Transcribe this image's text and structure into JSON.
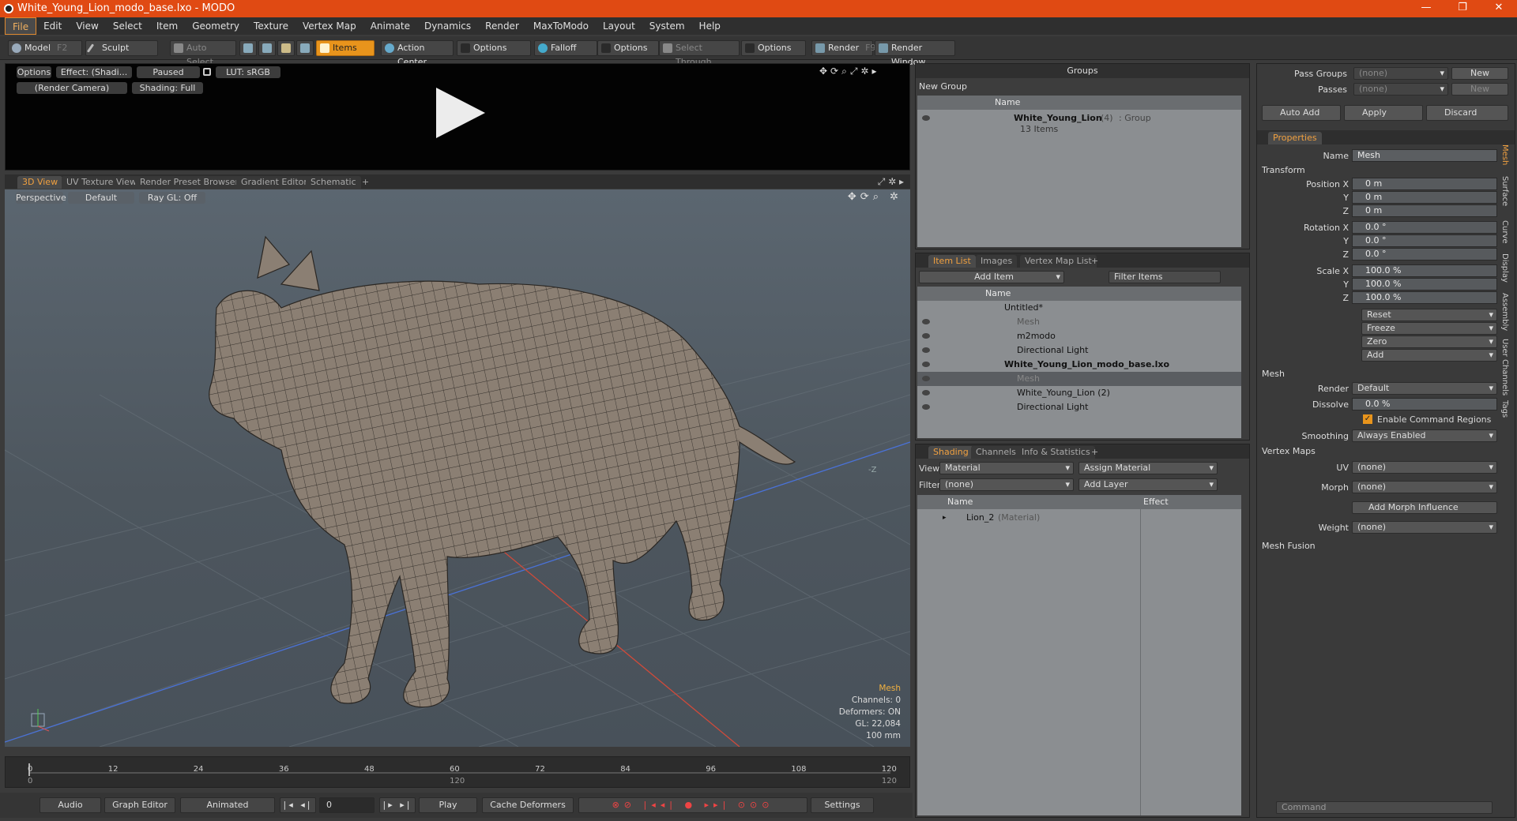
{
  "window": {
    "title": "White_Young_Lion_modo_base.lxo - MODO",
    "controls": [
      "—",
      "❐",
      "✕"
    ]
  },
  "menu": [
    "File",
    "Edit",
    "View",
    "Select",
    "Item",
    "Geometry",
    "Texture",
    "Vertex Map",
    "Animate",
    "Dynamics",
    "Render",
    "MaxToModo",
    "Layout",
    "System",
    "Help"
  ],
  "toolbar": {
    "model": "Model",
    "model_key": "F2",
    "sculpt": "Sculpt",
    "auto_select": "Auto Select",
    "items": "Items",
    "action_center": "Action Center",
    "options1": "Options",
    "falloff": "Falloff",
    "options2": "Options",
    "select_through": "Select Through",
    "options3": "Options",
    "render": "Render",
    "render_key": "F9",
    "render_window": "Render Window"
  },
  "preview": {
    "options": "Options",
    "effect": "Effect: (Shadi...",
    "paused": "Paused",
    "lut": "LUT: sRGB",
    "camera": "(Render Camera)",
    "shading": "Shading: Full"
  },
  "viewport_tabs": [
    "3D View",
    "UV Texture View",
    "Render Preset Browser",
    "Gradient Editor",
    "Schematic",
    "+"
  ],
  "viewport": {
    "perspective": "Perspective",
    "default": "Default",
    "raygl": "Ray GL: Off",
    "axis_label": "-Z",
    "info": {
      "title": "Mesh",
      "channels": "Channels: 0",
      "deformers": "Deformers: ON",
      "gl": "GL: 22,084",
      "size": "100 mm"
    }
  },
  "timeline": {
    "ticks_top": [
      "0",
      "12",
      "24",
      "36",
      "48",
      "60",
      "72",
      "84",
      "96",
      "108",
      "120"
    ],
    "ticks_bottom": [
      "0",
      "120",
      "120"
    ]
  },
  "bottombar": {
    "audio": "Audio",
    "graph_editor": "Graph Editor",
    "animated": "Animated",
    "frame": "0",
    "play": "Play",
    "cache": "Cache Deformers",
    "settings": "Settings"
  },
  "groups": {
    "title": "Groups",
    "new_group": "New Group",
    "col_name": "Name",
    "row_name": "White_Young_Lion",
    "row_count": "(4)",
    "row_type": ": Group",
    "row_items": "13 Items"
  },
  "item_list": {
    "tabs": [
      "Item List",
      "Images",
      "Vertex Map List",
      "+"
    ],
    "add_item": "Add Item",
    "filter": "Filter Items",
    "col_name": "Name",
    "rows": [
      {
        "label": "Untitled*",
        "indent": 0,
        "bold": false,
        "dim": false,
        "sel": false
      },
      {
        "label": "Mesh",
        "indent": 1,
        "bold": false,
        "dim": true,
        "sel": false
      },
      {
        "label": "m2modo",
        "indent": 1,
        "bold": false,
        "dim": false,
        "sel": false
      },
      {
        "label": "Directional Light",
        "indent": 1,
        "bold": false,
        "dim": false,
        "sel": false
      },
      {
        "label": "White_Young_Lion_modo_base.lxo",
        "indent": 0,
        "bold": true,
        "dim": false,
        "sel": false
      },
      {
        "label": "Mesh",
        "indent": 1,
        "bold": false,
        "dim": true,
        "sel": true
      },
      {
        "label": "White_Young_Lion (2)",
        "indent": 1,
        "bold": false,
        "dim": false,
        "sel": false
      },
      {
        "label": "Directional Light",
        "indent": 1,
        "bold": false,
        "dim": false,
        "sel": false
      }
    ]
  },
  "shading": {
    "tabs": [
      "Shading",
      "Channels",
      "Info & Statistics",
      "+"
    ],
    "view_label": "View",
    "view_value": "Material",
    "assign": "Assign Material",
    "filter_label": "Filter",
    "filter_value": "(none)",
    "add_layer": "Add Layer",
    "col_name": "Name",
    "col_effect": "Effect",
    "row_name": "Lion_2",
    "row_type": "(Material)"
  },
  "properties": {
    "pass_groups": "Pass Groups",
    "passes": "Passes",
    "none": "(none)",
    "new": "New",
    "auto_add": "Auto Add",
    "apply": "Apply",
    "discard": "Discard",
    "title": "Properties",
    "name_label": "Name",
    "name_value": "Mesh",
    "transform": "Transform",
    "pos_x_label": "Position X",
    "y_label": "Y",
    "z_label": "Z",
    "pos": [
      "0 m",
      "0 m",
      "0 m"
    ],
    "rot_label": "Rotation X",
    "rot": [
      "0.0 °",
      "0.0 °",
      "0.0 °"
    ],
    "scale_label": "Scale X",
    "scale": [
      "100.0 %",
      "100.0 %",
      "100.0 %"
    ],
    "reset": "Reset",
    "freeze": "Freeze",
    "zero": "Zero",
    "add": "Add",
    "mesh": "Mesh",
    "render_label": "Render",
    "render_value": "Default",
    "dissolve_label": "Dissolve",
    "dissolve_value": "0.0 %",
    "enable_cmd": "Enable Command Regions",
    "smoothing_label": "Smoothing",
    "smoothing_value": "Always Enabled",
    "vertex_maps": "Vertex Maps",
    "uv_label": "UV",
    "morph_label": "Morph",
    "add_morph": "Add Morph Influence",
    "weight_label": "Weight",
    "mesh_fusion": "Mesh Fusion",
    "command": "Command",
    "side_tabs": [
      "Mesh",
      "Surface",
      "Curve",
      "Display",
      "Assembly",
      "User Channels",
      "Tags"
    ]
  },
  "colors": {
    "accent": "#e8941c",
    "titlebar": "#e04a13"
  }
}
